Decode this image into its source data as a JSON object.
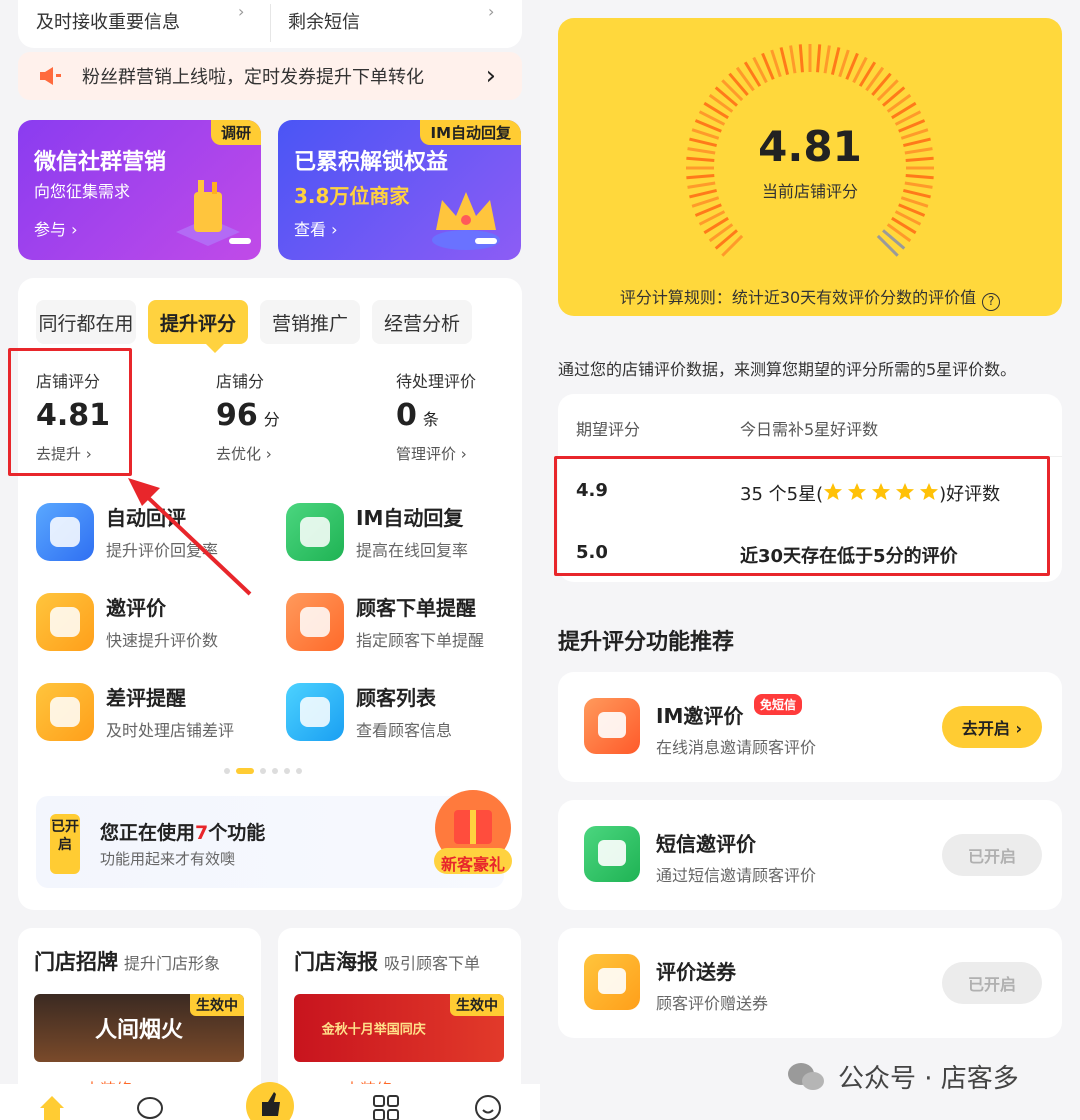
{
  "left": {
    "top_items": [
      {
        "label": "及时接收重要信息"
      },
      {
        "label": "剩余短信"
      }
    ],
    "notice": "粉丝群营销上线啦，定时发券提升下单转化",
    "promos": [
      {
        "tag": "调研",
        "title": "微信社群营销",
        "subtitle": "向您征集需求",
        "action": "参与 ›"
      },
      {
        "tag": "IM自动回复",
        "title": "已累积解锁权益",
        "subtitle": "3.8万位商家",
        "action": "查看 ›"
      }
    ],
    "tabs": [
      "同行都在用",
      "提升评分",
      "营销推广",
      "经营分析"
    ],
    "active_tab": "提升评分",
    "stats": [
      {
        "label": "店铺评分",
        "value": "4.81",
        "unit": "",
        "link": "去提升 ›"
      },
      {
        "label": "店铺分",
        "value": "96",
        "unit": "分",
        "link": "去优化 ›"
      },
      {
        "label": "待处理评价",
        "value": "0",
        "unit": "条",
        "link": "管理评价 ›"
      }
    ],
    "features": [
      {
        "title": "自动回评",
        "desc": "提升评价回复率",
        "color": "#3a8bff"
      },
      {
        "title": "IM自动回复",
        "desc": "提高在线回复率",
        "color": "#2ec763"
      },
      {
        "title": "邀评价",
        "desc": "快速提升评价数",
        "color": "#ffb21a"
      },
      {
        "title": "顾客下单提醒",
        "desc": "指定顾客下单提醒",
        "color": "#ff7a3d"
      },
      {
        "title": "差评提醒",
        "desc": "及时处理店铺差评",
        "color": "#ffb21a"
      },
      {
        "title": "顾客列表",
        "desc": "查看顾客信息",
        "color": "#1fb6f5"
      }
    ],
    "using": {
      "badge": "已开启",
      "prefix": "您正在使用",
      "count": "7",
      "suffix": "个功能",
      "sub": "功能用起来才有效噢",
      "gift_label": "新客豪礼"
    },
    "bottom_cards": [
      {
        "title": "门店招牌",
        "subtitle": "提升门店形象",
        "image_text": "人间烟火",
        "status": "生效中",
        "more": "去装修 ›"
      },
      {
        "title": "门店海报",
        "subtitle": "吸引顾客下单",
        "image_text": "金秋十月举国同庆",
        "status": "生效中",
        "more": "去装修 ›"
      }
    ]
  },
  "right": {
    "gauge": {
      "score": "4.81",
      "label": "当前店铺评分",
      "rule": "评分计算规则：统计近30天有效评价分数的评价值",
      "help_icon": "?",
      "score_value": 4.81,
      "score_max": 5
    },
    "explain": "通过您的店铺评价数据，来测算您期望的评分所需的5星评价数。",
    "expect": {
      "col1": "期望评分",
      "col2": "今日需补5星好评数",
      "rows": [
        {
          "score": "4.9",
          "prefix": "35 个5星(",
          "suffix": ")好评数"
        },
        {
          "score": "5.0",
          "text": "近30天存在低于5分的评价"
        }
      ]
    },
    "section_title": "提升评分功能推荐",
    "features": [
      {
        "name": "IM邀评价",
        "badge": "免短信",
        "desc": "在线消息邀请顾客评价",
        "button": "去开启 ›",
        "enabled": false,
        "color": "#ff7043"
      },
      {
        "name": "短信邀评价",
        "badge": "",
        "desc": "通过短信邀请顾客评价",
        "button": "已开启",
        "enabled": true,
        "color": "#22c45e"
      },
      {
        "name": "评价送券",
        "badge": "",
        "desc": "顾客评价赠送券",
        "button": "已开启",
        "enabled": true,
        "color": "#ffb300"
      }
    ],
    "watermark": "公众号 · 店客多"
  }
}
